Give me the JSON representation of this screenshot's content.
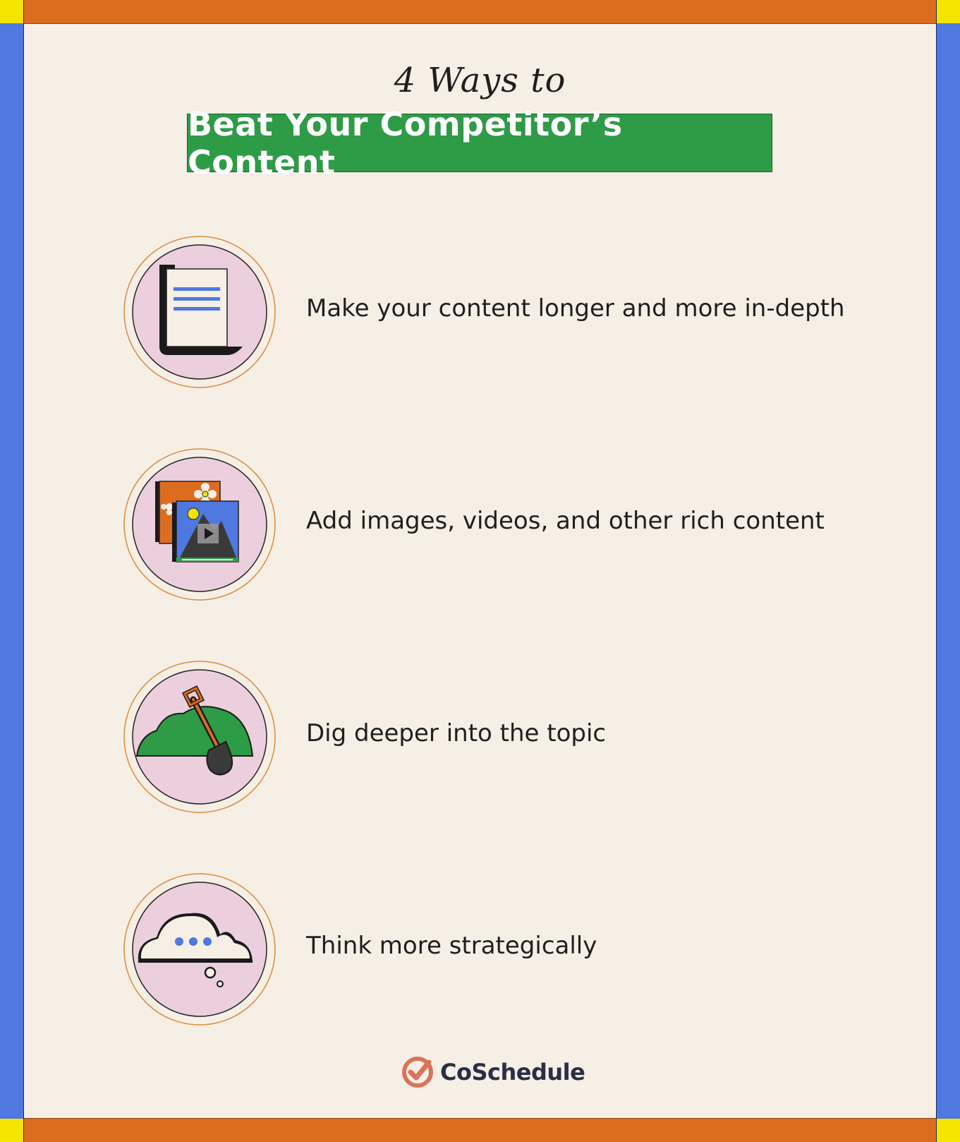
{
  "title": {
    "line1": "4 Ways to",
    "banner": "Beat Your Competitor’s Content"
  },
  "items": [
    {
      "text": "Make your content longer and more in-depth",
      "icon": "document-icon"
    },
    {
      "text": "Add images, videos, and other rich content",
      "icon": "media-gallery-icon"
    },
    {
      "text": "Dig deeper into the topic",
      "icon": "shovel-icon"
    },
    {
      "text": "Think more strategically",
      "icon": "thought-cloud-icon"
    }
  ],
  "brand": {
    "name": "CoSchedule",
    "logo_icon": "coschedule-logo-icon"
  },
  "colors": {
    "frame_orange": "#dc6d1f",
    "frame_blue": "#4f78e0",
    "corner_yellow": "#f4e400",
    "banner_green": "#2e9b47",
    "background": "#f6efe6",
    "badge_fill": "#eccfdc"
  }
}
